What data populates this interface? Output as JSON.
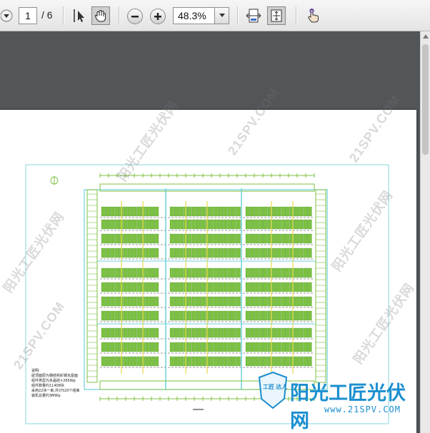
{
  "toolbar": {
    "page_current": "1",
    "page_total": "/ 6",
    "zoom_value": "48.3%",
    "icons": [
      "down-arrow-icon",
      "text-select-icon",
      "hand-tool-icon",
      "zoom-out-icon",
      "zoom-in-icon",
      "fit-width-icon",
      "fit-page-icon",
      "touch-read-icon"
    ]
  },
  "watermark": {
    "cn": "阳光工匠光伏网",
    "en": "21SPV.COM"
  },
  "logo": {
    "title": "阳光工匠光伏网",
    "url": "www.21SPV.COM",
    "badge": "工匠 达人"
  },
  "drawing": {
    "notes": [
      "说明:",
      "屋顶面层为钢结构彩钢瓦屋面",
      "组件类型为多晶硅×265Wp",
      "组件数量约11408块",
      "采用22块一串,共计520个组串",
      "装机总量约3MWp"
    ]
  },
  "colors": {
    "accent": "#1b8fcf",
    "drawing_green": "#7cc242",
    "drawing_yellow": "#e8d84a",
    "drawing_cyan": "#6fd0d8"
  }
}
